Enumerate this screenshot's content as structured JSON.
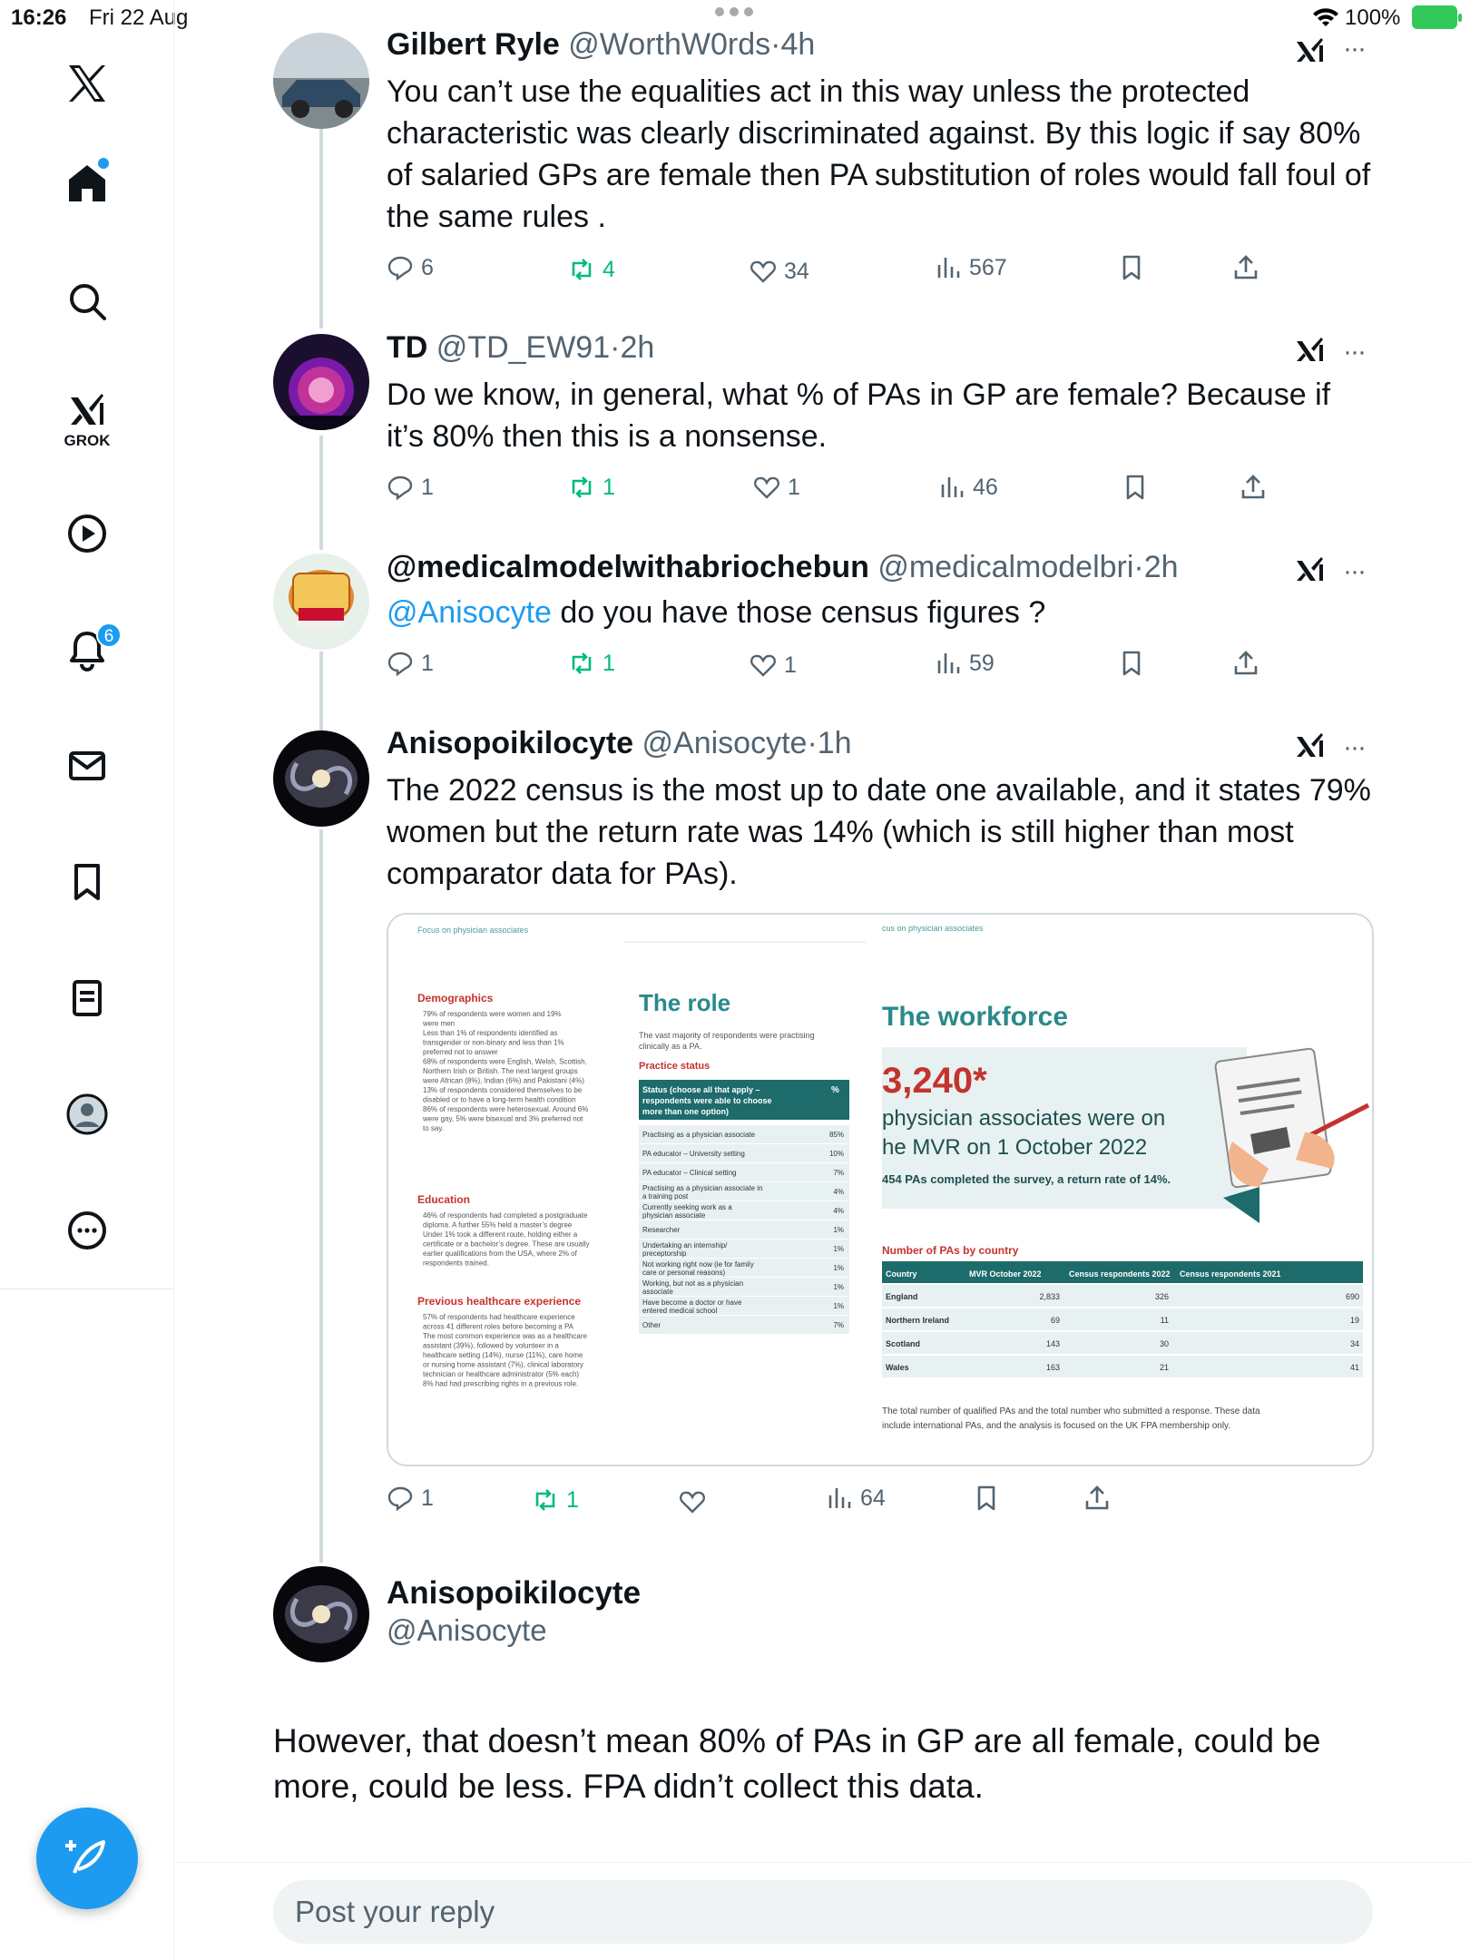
{
  "status_bar": {
    "time": "16:26",
    "date": "Fri 22 Aug",
    "battery": "100%"
  },
  "sidebar": {
    "grok_label": "GROK",
    "notification_count": "6",
    "items": [
      "x-logo-icon",
      "home-icon",
      "search-icon",
      "grok-icon",
      "video-icon",
      "bell-icon",
      "mail-icon",
      "bookmark-icon",
      "lists-icon",
      "profile-icon",
      "more-icon"
    ]
  },
  "posts": [
    {
      "name": "Gilbert Ryle",
      "handle": "@WorthW0rds",
      "time": "4h",
      "text": "You can’t use the equalities act in this way unless the protected characteristic was clearly discriminated against. By this logic if say 80% of salaried GPs are female then PA substitution of roles would fall foul of the same rules .",
      "replies": "6",
      "reposts": "4",
      "likes": "34",
      "views": "567"
    },
    {
      "name": "TD",
      "handle": "@TD_EW91",
      "time": "2h",
      "text": "Do we know, in general, what % of PAs in GP are female? Because if it’s 80% then this is a nonsense.",
      "replies": "1",
      "reposts": "1",
      "likes": "1",
      "views": "46"
    },
    {
      "name": "@medicalmodelwithabriochebun",
      "handle": "@medicalmodelbri",
      "time": "2h",
      "mention": "@Anisocyte",
      "text": " do you have those census figures ?",
      "replies": "1",
      "reposts": "1",
      "likes": "1",
      "views": "59"
    },
    {
      "name": "Anisopoikilocyte",
      "handle": "@Anisocyte",
      "time": "1h",
      "text": "The 2022 census is the most up to date one available, and it states 79% women but the return rate was 14% (which is still higher than most comparator data for PAs).",
      "replies": "1",
      "reposts": "1",
      "likes": "",
      "views": "64"
    }
  ],
  "media": {
    "left_header": "Focus on physician associates",
    "right_header": "cus on physician associates",
    "demographics_title": "Demographics",
    "demographics_bullets": [
      "79% of respondents were women and 19%",
      "were men",
      "Less than 1% of respondents identified as",
      "transgender or non-binary and less than 1%",
      "preferred not to answer",
      "68% of respondents were English, Welsh, Scottish,",
      "Northern Irish or British. The next largest groups",
      "were African (8%), Indian (6%) and Pakistani (4%)",
      "13% of respondents considered themselves to be",
      "disabled or to have a long-term health condition",
      "86% of respondents were heterosexual. Around 6%",
      "were gay, 5% were bisexual and 3% preferred not",
      "to say."
    ],
    "education_title": "Education",
    "education_bullets": [
      "46% of respondents had completed a postgraduate",
      "diploma. A further 55% held a master’s degree",
      "Under 1% took a different route, holding either a",
      "certificate or a bachelor’s degree. These are usually",
      "earlier qualifications from the USA, where 2% of",
      "respondents trained."
    ],
    "prev_title": "Previous healthcare experience",
    "prev_bullets": [
      "57% of respondents had healthcare experience",
      "across 41 different roles before becoming a PA",
      "The most common experience was as a healthcare",
      "assistant (39%), followed by volunteer in a",
      "healthcare setting (14%), nurse (11%), care home",
      "or nursing home assistant (7%), clinical laboratory",
      "technician or healthcare administrator (5% each)",
      "8% had had prescribing rights in a previous role."
    ],
    "role_title": "The role",
    "role_sub1": "The vast majority of respondents were practising",
    "role_sub2": "clinically as a PA.",
    "practice_status": "Practice status",
    "status_head": [
      "Status (choose all that apply –",
      "respondents were able to choose",
      "more than one option)"
    ],
    "status_pct_head": "%",
    "status_rows": [
      {
        "l1": "Practising as a physician associate",
        "l2": "",
        "v": "85%"
      },
      {
        "l1": "PA educator – University setting",
        "l2": "",
        "v": "10%"
      },
      {
        "l1": "PA educator – Clinical setting",
        "l2": "",
        "v": "7%"
      },
      {
        "l1": "Practising as a physician associate in",
        "l2": "a training post",
        "v": "4%"
      },
      {
        "l1": "Currently seeking work as a",
        "l2": "physician associate",
        "v": "4%"
      },
      {
        "l1": "Researcher",
        "l2": "",
        "v": "1%"
      },
      {
        "l1": "Undertaking an internship/",
        "l2": "preceptorship",
        "v": "1%"
      },
      {
        "l1": "Not working right now (ie for family",
        "l2": "care or personal reasons)",
        "v": "1%"
      },
      {
        "l1": "Working, but not as a physician",
        "l2": "associate",
        "v": "1%"
      },
      {
        "l1": "Have become a doctor or have",
        "l2": "entered medical school",
        "v": "1%"
      },
      {
        "l1": "Other",
        "l2": "",
        "v": "7%"
      }
    ],
    "workforce_title": "The workforce",
    "big_number": "3,240*",
    "wf_line1": "physician associates were on",
    "wf_line2": "he MVR on 1 October 2022",
    "wf_line3": "454 PAs completed the survey, a return rate of 14%.",
    "country_title": "Number of PAs by country",
    "country_head": [
      "Country",
      "MVR October 2022",
      "Census respondents 2022",
      "Census respondents 2021"
    ],
    "country_rows": [
      [
        "England",
        "2,833",
        "326",
        "690"
      ],
      [
        "Northern Ireland",
        "69",
        "11",
        "19"
      ],
      [
        "Scotland",
        "143",
        "30",
        "34"
      ],
      [
        "Wales",
        "163",
        "21",
        "41"
      ]
    ],
    "foot1": "The total number of qualified PAs and the total number who submitted a response. These data",
    "foot2": "include international PAs, and the analysis is focused on the UK FPA membership only."
  },
  "focal": {
    "name": "Anisopoikilocyte",
    "handle": "@Anisocyte",
    "text": "However, that doesn’t mean 80% of PAs in GP are all female, could be more, could be less. FPA didn’t collect this data."
  },
  "reply_placeholder": "Post your reply"
}
